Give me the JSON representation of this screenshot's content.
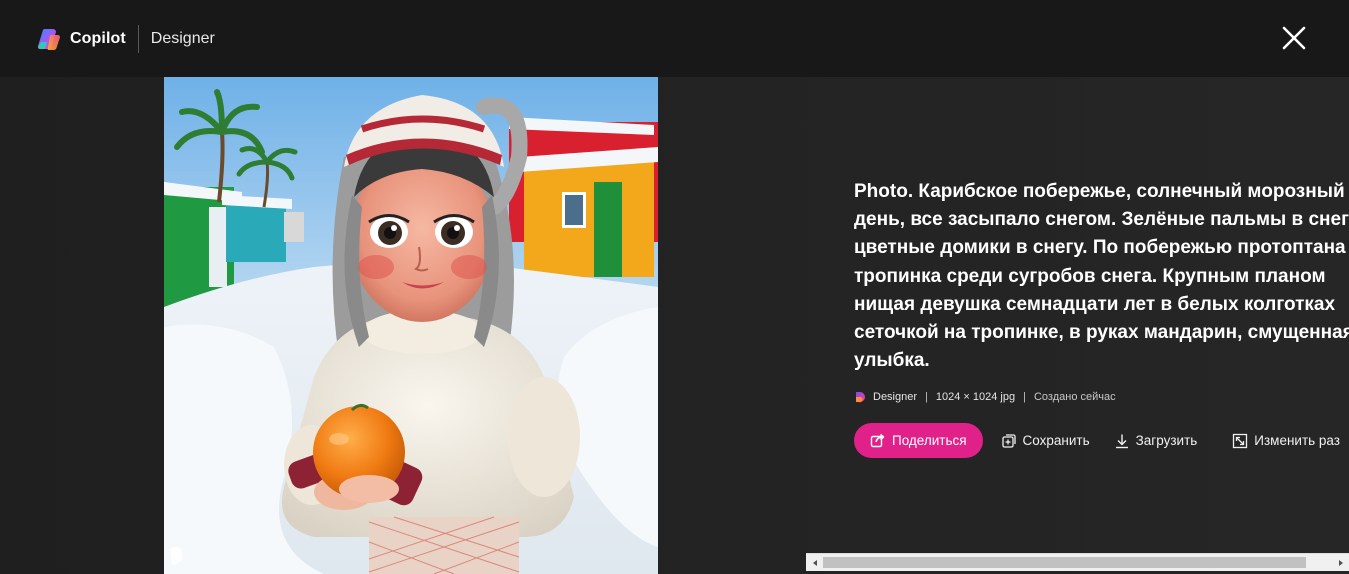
{
  "header": {
    "brand_name": "Copilot",
    "section": "Designer"
  },
  "image": {
    "alt": "Photo"
  },
  "details": {
    "prompt": "Photo. Карибское побережье, солнечный морозный день, все засыпало снегом. Зелёные пальмы в снегу, цветные домики в снегу. По побережью протоптана тропинка среди сугробов снега. Крупным планом нищая девушка семнадцати лет в белых колготках сеточкой на тропинке, в руках мандарин, смущенная улыбка.",
    "meta": {
      "app": "Designer",
      "size": "1024 × 1024 jpg",
      "created": "Создано сейчас",
      "separator": "|"
    },
    "actions": {
      "share": "Поделиться",
      "save": "Сохранить",
      "download": "Загрузить",
      "resize": "Изменить раз"
    }
  },
  "colors": {
    "accent": "#e0218a",
    "header_bg": "#181818",
    "page_bg": "#222222"
  },
  "icons": {
    "close": "close-icon",
    "share": "share-icon",
    "save": "save-icon",
    "download": "download-icon",
    "resize": "resize-icon"
  }
}
